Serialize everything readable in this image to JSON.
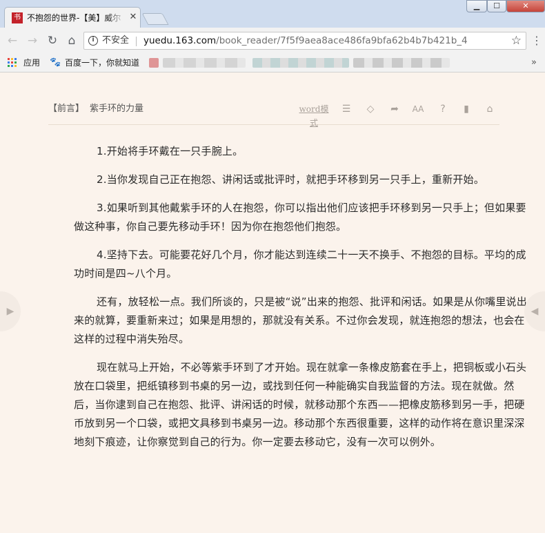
{
  "tab": {
    "title": "不抱怨的世界-【美】威尔",
    "favicon_glyph": "书",
    "close": "✕"
  },
  "window": {
    "minimize": "▁",
    "maximize": "☐",
    "close": "✕"
  },
  "toolbar": {
    "back": "←",
    "forward": "→",
    "reload": "↻",
    "home": "⌂",
    "info_icon": "i",
    "security_label": "不安全",
    "url_host": "yuedu.163.com",
    "url_path": "/book_reader/7f5f9aea8ace486fa9bfa62b4b7b421b_4",
    "star": "☆",
    "menu": "⋮"
  },
  "bookmarks": {
    "apps_label": "应用",
    "baidu_label": "百度一下，你就知道",
    "more": "»"
  },
  "reader": {
    "chapter_tag": "【前言】",
    "chapter_title": "紫手环的力量",
    "tools": {
      "word_mode": "word模式",
      "list": "☰",
      "diamond": "◇",
      "share": "➦",
      "font": "AA",
      "help": "?",
      "bookmark": "▮",
      "home": "⌂"
    },
    "prev_arrow": "▶",
    "next_arrow": "◀",
    "paragraphs": [
      "1.开始将手环戴在一只手腕上。",
      "2.当你发现自己正在抱怨、讲闲话或批评时，就把手环移到另一只手上，重新开始。",
      "3.如果听到其他戴紫手环的人在抱怨，你可以指出他们应该把手环移到另一只手上；但如果要做这种事，你自己要先移动手环！因为你在抱怨他们抱怨。",
      "4.坚持下去。可能要花好几个月，你才能达到连续二十一天不换手、不抱怨的目标。平均的成功时间是四~八个月。",
      "还有，放轻松一点。我们所谈的，只是被“说”出来的抱怨、批评和闲话。如果是从你嘴里说出来的就算，要重新来过；如果是用想的，那就没有关系。不过你会发现，就连抱怨的想法，也会在这样的过程中消失殆尽。",
      "现在就马上开始，不必等紫手环到了才开始。现在就拿一条橡皮筋套在手上，把铜板或小石头放在口袋里，把纸镇移到书桌的另一边，或找到任何一种能确实自我监督的方法。现在就做。然后，当你逮到自己在抱怨、批评、讲闲话的时候，就移动那个东西——把橡皮筋移到另一手，把硬币放到另一个口袋，或把文具移到书桌另一边。移动那个东西很重要，这样的动作将在意识里深深地刻下痕迹，让你察觉到自己的行为。你一定要去移动它，没有一次可以例外。"
    ]
  }
}
